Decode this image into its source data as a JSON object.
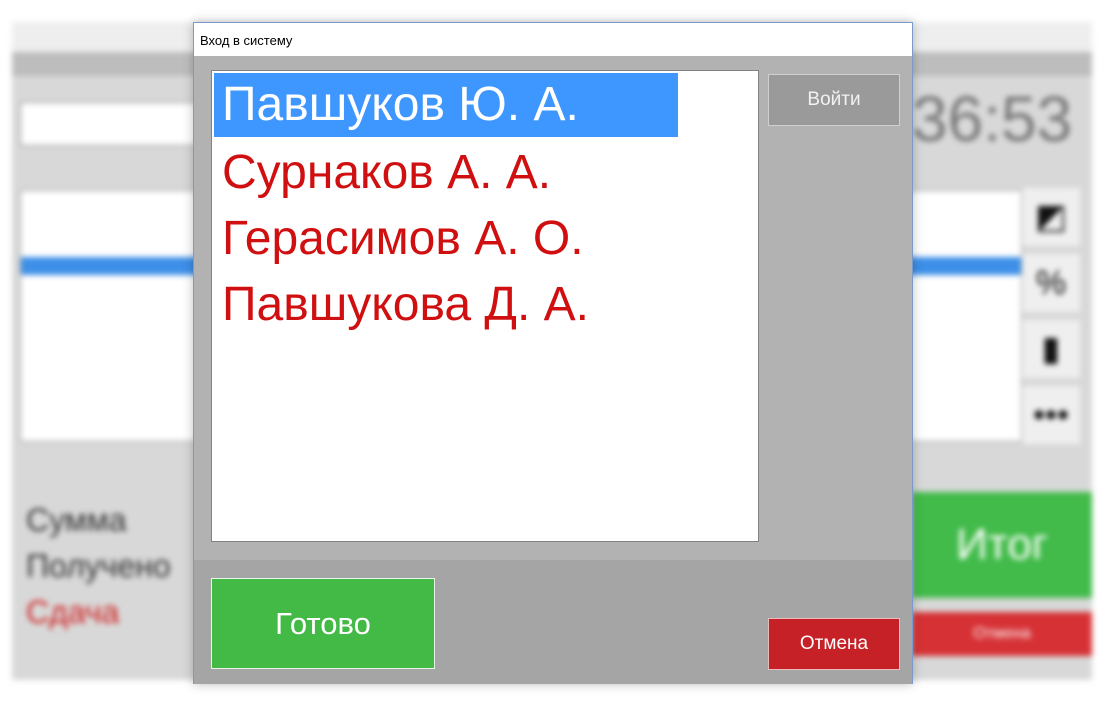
{
  "dialog": {
    "title": "Вход в систему",
    "users": [
      {
        "name": "Павшуков Ю. А.",
        "selected": true
      },
      {
        "name": "Сурнаков А. А.",
        "selected": false
      },
      {
        "name": "Герасимов А. О.",
        "selected": false
      },
      {
        "name": "Павшукова Д. А.",
        "selected": false
      }
    ],
    "login_label": "Войти",
    "done_label": "Готово",
    "cancel_label": "Отмена"
  },
  "background": {
    "clock": "36:53",
    "total_label": "Итог",
    "cancel_label": "Отмена",
    "sum_label": "Сумма",
    "received_label": "Получено",
    "change_label": "Сдача"
  },
  "colors": {
    "user_text": "#d01010",
    "selection": "#3d97ff",
    "done_button": "#43b946",
    "cancel_button": "#c62127",
    "login_button": "#9a9a9a"
  }
}
